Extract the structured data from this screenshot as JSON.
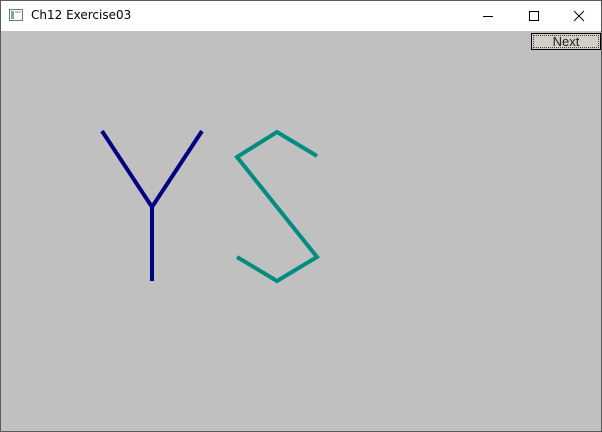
{
  "window": {
    "title": "Ch12 Exercise03",
    "icon": "app-window-icon",
    "controls": [
      "minimize-icon",
      "maximize-icon",
      "close-icon"
    ]
  },
  "toolbar": {
    "next_label": "Next"
  },
  "colors": {
    "background": "#c0c0c0",
    "letter_y": "#000080",
    "letter_s": "#008c80"
  }
}
